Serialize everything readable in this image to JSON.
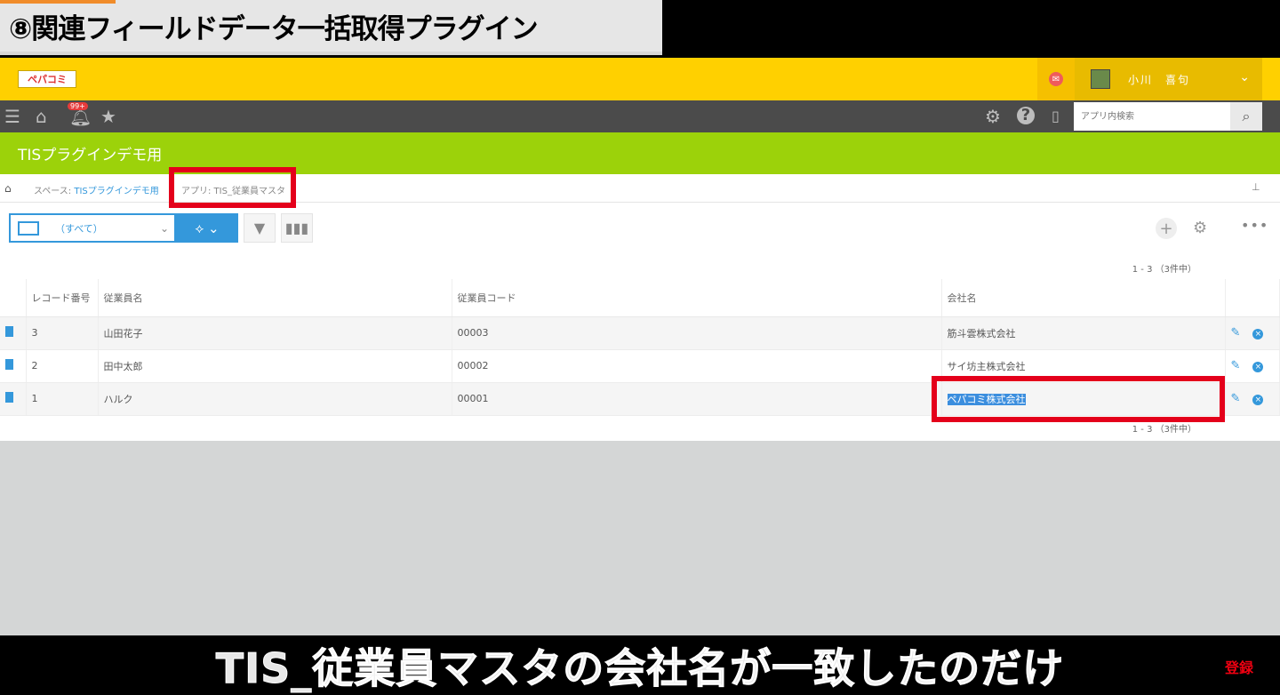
{
  "banner": {
    "title": "⑧関連フィールドデータ一括取得プラグイン"
  },
  "header": {
    "logo_text": "ペパコミ",
    "mail_icon": "envelope-icon",
    "user_name": "小川　喜句"
  },
  "toolbar": {
    "bell_badge": "99+",
    "search_placeholder": "アプリ内検索"
  },
  "space_title": "TISプラグインデモ用",
  "breadcrumb": {
    "space_prefix": "スペース: ",
    "space_name": "TISプラグインデモ用",
    "app": "アプリ: TIS_従業員マスタ"
  },
  "view": {
    "selected": "（すべて）"
  },
  "pager_top": "1 - 3 （3件中）",
  "pager_bottom": "1 - 3 （3件中）",
  "table": {
    "columns": [
      "レコード番号",
      "従業員名",
      "従業員コード",
      "会社名"
    ],
    "rows": [
      {
        "no": "3",
        "name": "山田花子",
        "code": "00003",
        "company": "筋斗雲株式会社"
      },
      {
        "no": "2",
        "name": "田中太郎",
        "code": "00002",
        "company": "サイ坊主株式会社"
      },
      {
        "no": "1",
        "name": "ハルク",
        "code": "00001",
        "company": "ペパコミ株式会社"
      }
    ]
  },
  "subtitle": "TIS_従業員マスタの会社名が一致したのだけ",
  "register_label": "登録",
  "colors": {
    "kintone_yellow": "#ffd000",
    "space_green": "#9cd20a",
    "accent_blue": "#3498db",
    "highlight_red": "#e4001b"
  }
}
